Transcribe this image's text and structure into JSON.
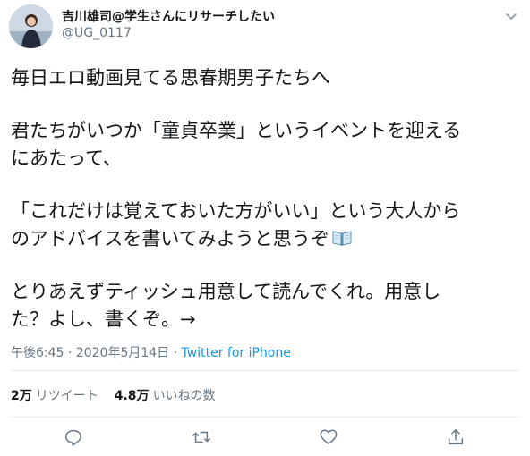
{
  "author": {
    "display_name": "吉川雄司@学生さんにリサーチしたい",
    "handle": "@UG_0117"
  },
  "tweet": {
    "line1": "毎日エロ動画見てる思春期男子たちへ",
    "line2": "君たちがいつか「童貞卒業」というイベントを迎える",
    "line3": "にあたって、",
    "line4": "「これだけは覚えておいた方がいい」という大人から",
    "line5": "のアドバイスを書いてみようと思うぞ",
    "line6": "とりあえずティッシュ用意して読んでくれ。用意し",
    "line7": "た？よし、書くぞ。→"
  },
  "meta": {
    "time": "午後6:45",
    "separator1": " · ",
    "date": "2020年5月14日",
    "separator2": " · ",
    "source": "Twitter for iPhone"
  },
  "stats": {
    "retweets_count": "2万",
    "retweets_label": "リツイート",
    "likes_count": "4.8万",
    "likes_label": "いいねの数"
  },
  "icons": {
    "caret": "chevron-down-icon",
    "reply": "reply-icon",
    "retweet": "retweet-icon",
    "like": "heart-icon",
    "share": "share-icon",
    "emoji": "open-book-icon"
  },
  "colors": {
    "text": "#14171a",
    "secondary": "#657786",
    "link": "#1b95e0",
    "divider": "#e6ecf0"
  }
}
